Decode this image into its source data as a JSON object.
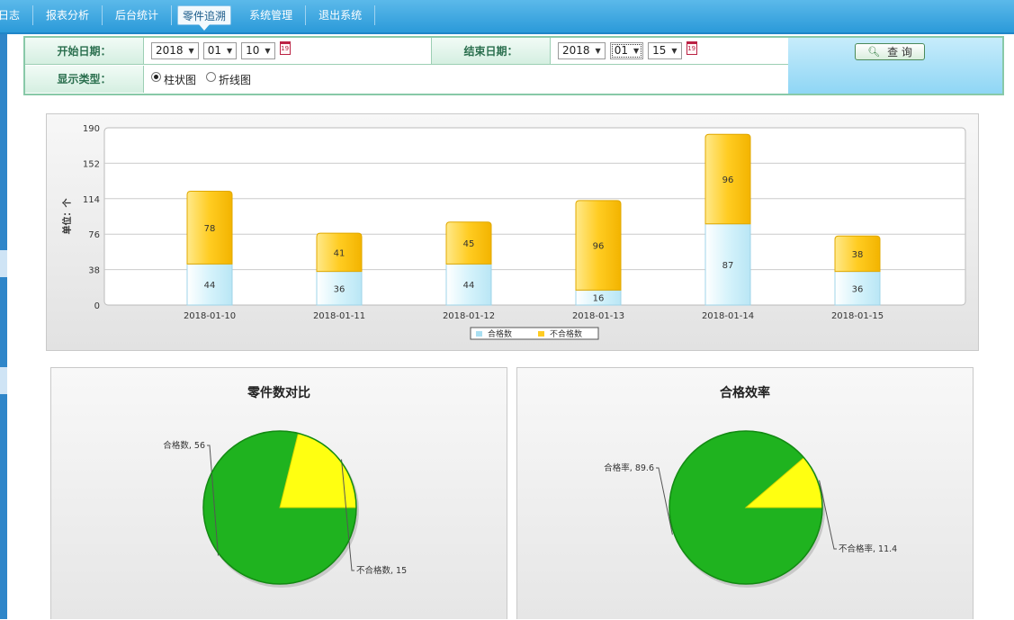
{
  "nav": {
    "items": [
      {
        "label": "日志",
        "active": false
      },
      {
        "label": "报表分析",
        "active": false
      },
      {
        "label": "后台统计",
        "active": false
      },
      {
        "label": "零件追溯",
        "active": true
      },
      {
        "label": "系统管理",
        "active": false
      },
      {
        "label": "退出系统",
        "active": false
      }
    ]
  },
  "filter": {
    "start_label": "开始日期：",
    "end_label": "结束日期：",
    "type_label": "显示类型：",
    "start": {
      "year": "2018",
      "month": "01",
      "day": "10"
    },
    "end": {
      "year": "2018",
      "month": "01",
      "day": "15"
    },
    "calendar_icon_text": "19",
    "radio_bar": "柱状图",
    "radio_line": "折线图",
    "selected_type": "bar",
    "query_label": "查 询"
  },
  "chart_data": [
    {
      "type": "bar",
      "stacked": true,
      "categories": [
        "2018-01-10",
        "2018-01-11",
        "2018-01-12",
        "2018-01-13",
        "2018-01-14",
        "2018-01-15"
      ],
      "series": [
        {
          "name": "合格数",
          "values": [
            44,
            36,
            44,
            16,
            87,
            36
          ],
          "color": "#d6f3fb"
        },
        {
          "name": "不合格数",
          "values": [
            78,
            41,
            45,
            96,
            96,
            38
          ],
          "color": "#ffcc22"
        }
      ],
      "ylabel": "单位：个",
      "yticks": [
        0,
        38,
        76,
        114,
        152,
        190
      ],
      "ylim": [
        0,
        190
      ],
      "grid": true,
      "legend": "bottom-center"
    },
    {
      "type": "pie",
      "title": "零件数对比",
      "slices": [
        {
          "label": "合格数",
          "value": 56,
          "color": "#1fb31f"
        },
        {
          "label": "不合格数",
          "value": 15,
          "color": "#ffff11"
        }
      ]
    },
    {
      "type": "pie",
      "title": "合格效率",
      "slices": [
        {
          "label": "合格率",
          "value": 89.6,
          "color": "#1fb31f"
        },
        {
          "label": "不合格率",
          "value": 11.4,
          "color": "#ffff11"
        }
      ]
    }
  ]
}
